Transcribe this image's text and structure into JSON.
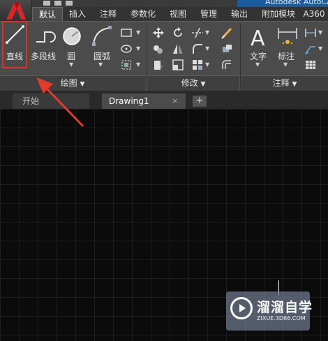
{
  "title_text": "Autodesk AutoCA",
  "ribbon_tabs": [
    "默认",
    "插入",
    "注释",
    "参数化",
    "视图",
    "管理",
    "输出",
    "附加模块",
    "A360"
  ],
  "active_tab": "默认",
  "panels": {
    "draw": {
      "title": "绘图",
      "tools": [
        {
          "label": "直线",
          "icon": "line-icon"
        },
        {
          "label": "多段线",
          "icon": "polyline-icon"
        },
        {
          "label": "圆",
          "icon": "circle-icon"
        },
        {
          "label": "圆弧",
          "icon": "arc-icon"
        }
      ],
      "small_tools": [
        "rectangle-icon",
        "ellipse-icon",
        "hatch-icon"
      ]
    },
    "modify": {
      "title": "修改",
      "small_tools": [
        "move-icon",
        "rotate-icon",
        "trim-icon",
        "erase-icon",
        "copy-icon",
        "mirror-icon",
        "fillet-icon",
        "explode-icon",
        "stretch-icon",
        "scale-icon",
        "array-icon",
        "offset-icon"
      ]
    },
    "annotation": {
      "title": "注释",
      "tools": [
        {
          "label": "文字",
          "icon": "text-icon"
        },
        {
          "label": "标注",
          "icon": "dimension-icon"
        }
      ],
      "small_tools": [
        "linear-dim-icon",
        "leader-icon",
        "table-icon"
      ]
    }
  },
  "doc_tabs": [
    {
      "label": "开始",
      "active": false
    },
    {
      "label": "Drawing1",
      "active": true
    }
  ],
  "close_glyph": "×",
  "add_tab_glyph": "+",
  "dropdown_glyph": "▼",
  "watermark": {
    "name": "溜溜自学",
    "url": "ZIXUE.3D66.COM"
  },
  "colors": {
    "highlight": "#e0302a",
    "ribbon": "#4b4b4b",
    "canvas": "#0b0b0b"
  }
}
